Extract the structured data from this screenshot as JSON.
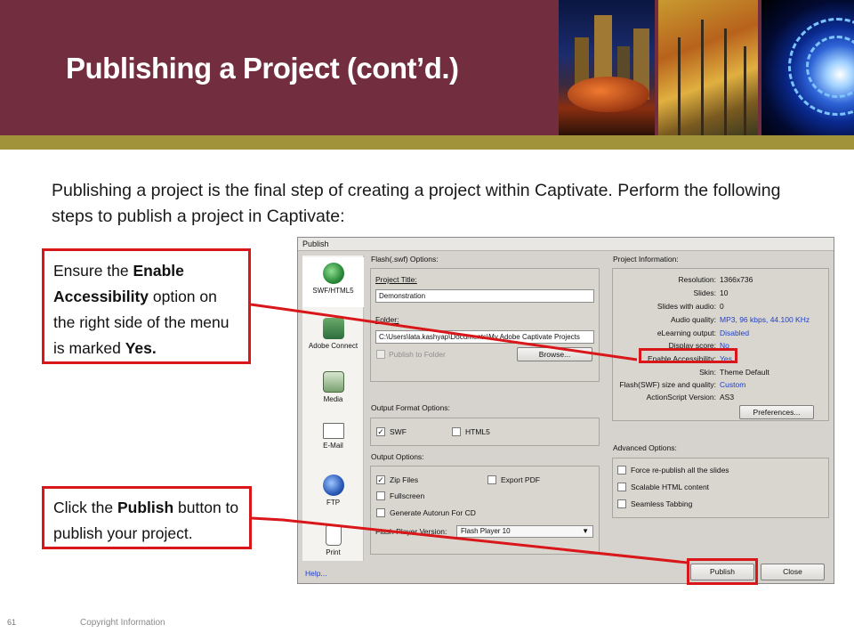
{
  "header": {
    "title": "Publishing a Project (cont’d.)",
    "colors": {
      "banner": "#722e3e",
      "band": "#a1933a",
      "callout_border": "#d9171a"
    }
  },
  "intro_text": "Publishing a project is the final step of creating a project within Captivate. Perform the following steps to publish a project in Captivate:",
  "callout_accessibility": {
    "part1": "Ensure the ",
    "bold1": "Enable Accessibility",
    "part2": " option on the right side of the menu is marked ",
    "bold2": "Yes."
  },
  "callout_publish": {
    "part1": "Click the ",
    "bold1": "Publish",
    "part2": " button to publish your project."
  },
  "dialog": {
    "title": "Publish",
    "sidebar": [
      {
        "label": "SWF/HTML5",
        "icon": "globe-icon"
      },
      {
        "label": "Adobe Connect",
        "icon": "adobe-connect-icon"
      },
      {
        "label": "Media",
        "icon": "media-icon"
      },
      {
        "label": "E-Mail",
        "icon": "email-icon"
      },
      {
        "label": "FTP",
        "icon": "ftp-icon"
      },
      {
        "label": "Print",
        "icon": "print-icon"
      }
    ],
    "flash_options": {
      "heading": "Flash(.swf) Options:",
      "project_title_label": "Project Title:",
      "project_title_value": "Demonstration",
      "folder_label": "Folder:",
      "folder_value": "C:\\Users\\lata.kashyap\\Documents\\My Adobe Captivate Projects",
      "publish_to_folder": "Publish to Folder",
      "browse": "Browse..."
    },
    "output_format": {
      "heading": "Output Format Options:",
      "swf": "SWF",
      "html5": "HTML5"
    },
    "output_options": {
      "heading": "Output Options:",
      "zip": "Zip Files",
      "export_pdf": "Export PDF",
      "fullscreen": "Fullscreen",
      "autorun": "Generate Autorun For CD",
      "flash_version_label": "Flash Player Version:",
      "flash_version_value": "Flash Player 10"
    },
    "project_info": {
      "heading": "Project Information:",
      "rows": [
        {
          "key": "Resolution:",
          "value": "1366x736",
          "link": false
        },
        {
          "key": "Slides:",
          "value": "10",
          "link": false
        },
        {
          "key": "Slides with audio:",
          "value": "0",
          "link": false
        },
        {
          "key": "Audio quality:",
          "value": "MP3, 96 kbps, 44.100 KHz",
          "link": true
        },
        {
          "key": "eLearning output:",
          "value": "Disabled",
          "link": true
        },
        {
          "key": "Display score:",
          "value": "No",
          "link": true
        },
        {
          "key": "Enable Accessibility:",
          "value": "Yes",
          "link": true
        },
        {
          "key": "Skin:",
          "value": "Theme Default",
          "link": false
        },
        {
          "key": "Flash(SWF) size and quality:",
          "value": "Custom",
          "link": true
        },
        {
          "key": "ActionScript Version:",
          "value": "AS3",
          "link": false
        }
      ],
      "preferences": "Preferences..."
    },
    "advanced": {
      "heading": "Advanced Options:",
      "items": [
        "Force re-publish all the slides",
        "Scalable HTML content",
        "Seamless Tabbing"
      ]
    },
    "help": "Help...",
    "publish": "Publish",
    "close": "Close"
  },
  "footer": {
    "slide_number": "61",
    "copyright": "Copyright Information"
  }
}
